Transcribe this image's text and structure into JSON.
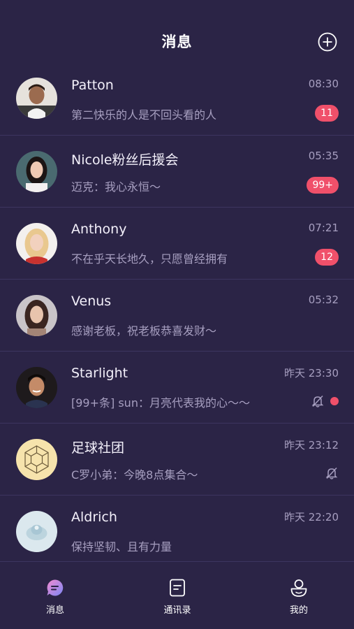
{
  "header": {
    "title": "消息",
    "add_icon": "plus-circle-icon"
  },
  "conversations": [
    {
      "name": "Patton",
      "preview": "第二快乐的人是不回头看的人",
      "time": "08:30",
      "badge": "11"
    },
    {
      "name": "Nicole粉丝后援会",
      "preview": "迈克：我心永恒～",
      "time": "05:35",
      "badge": "99+"
    },
    {
      "name": "Anthony",
      "preview": "不在乎天长地久，只愿曾经拥有",
      "time": "07:21",
      "badge": "12"
    },
    {
      "name": "Venus",
      "preview": "感谢老板，祝老板恭喜发财～",
      "time": "05:32"
    },
    {
      "name": "Starlight",
      "preview": "[99+条] sun：月亮代表我的心～～",
      "time": "昨天 23:30",
      "muted": true,
      "unread_dot": true
    },
    {
      "name": "足球社团",
      "preview": "C罗小弟：今晚8点集合～",
      "time": "昨天 23:12",
      "muted": true
    },
    {
      "name": "Aldrich",
      "preview": "保持坚韧、且有力量",
      "time": "昨天 22:20"
    }
  ],
  "tabs": [
    {
      "label": "消息",
      "icon": "chat-bubble-icon",
      "active": true
    },
    {
      "label": "通讯录",
      "icon": "contacts-book-icon"
    },
    {
      "label": "我的",
      "icon": "profile-icon"
    }
  ],
  "colors": {
    "background": "#2b2446",
    "badge": "#f0506a",
    "muted_text": "#a79fc0",
    "divider": "#3d3560"
  }
}
